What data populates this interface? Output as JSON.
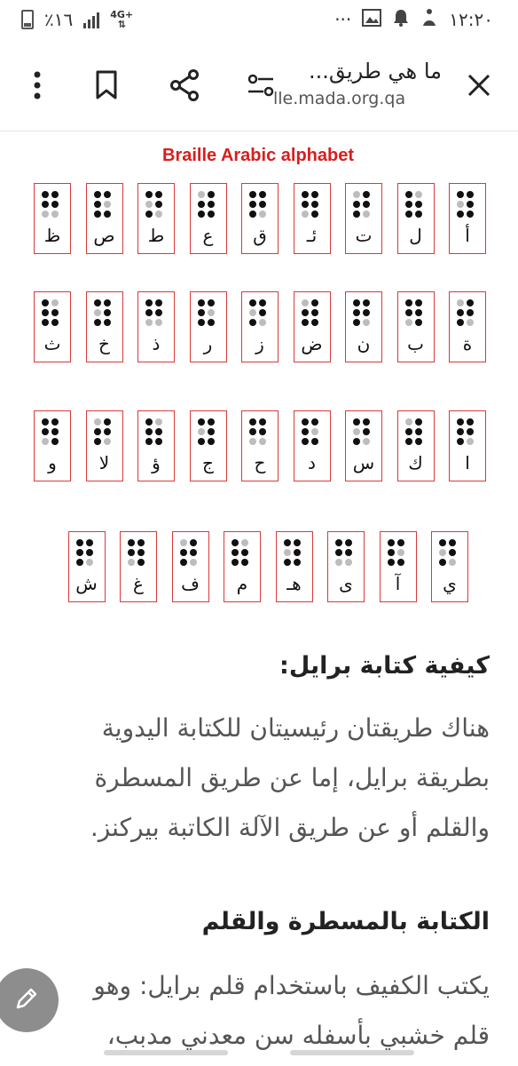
{
  "status_bar": {
    "battery": "٪١٦",
    "network": "4G+",
    "more": "···",
    "time": "١٢:٢٠"
  },
  "toolbar": {
    "page_title": "ما هي طريق...",
    "url": "lle.mada.org.qa"
  },
  "figure": {
    "title": "Braille Arabic alphabet",
    "rows": [
      [
        "أ",
        "ل",
        "ت",
        "ئـ",
        "ق",
        "ع",
        "ط",
        "ص",
        "ظ"
      ],
      [
        "ة",
        "ب",
        "ن",
        "ض",
        "ز",
        "ر",
        "ذ",
        "خ",
        "ث"
      ],
      [
        "ا",
        "ك",
        "س",
        "د",
        "ح",
        "ج",
        "ؤ",
        "لا",
        "و"
      ],
      [
        "ي",
        "آ",
        "ى",
        "هـ",
        "م",
        "ف",
        "غ",
        "ش"
      ]
    ]
  },
  "article": {
    "heading1": "كيفية كتابة برايل:",
    "paragraph1_lines": [
      "هناك طريقتان رئيسيتان للكتابة اليدوية",
      "بطريقة برايل، إما عن طريق المسطرة",
      "والقلم أو عن طريق الآلة الكاتبة بيركنز."
    ],
    "heading2": "الكتابة بالمسطرة والقلم",
    "paragraph2_lines": [
      "يكتب الكفيف باستخدام قلم برايل: وهو",
      "قلم خشبي بأسفله سن معدني مدبب،"
    ]
  },
  "colors": {
    "accent_red": "#d81e1e",
    "border_red": "#d93a3a",
    "fab_gray": "#8d8d8d"
  }
}
